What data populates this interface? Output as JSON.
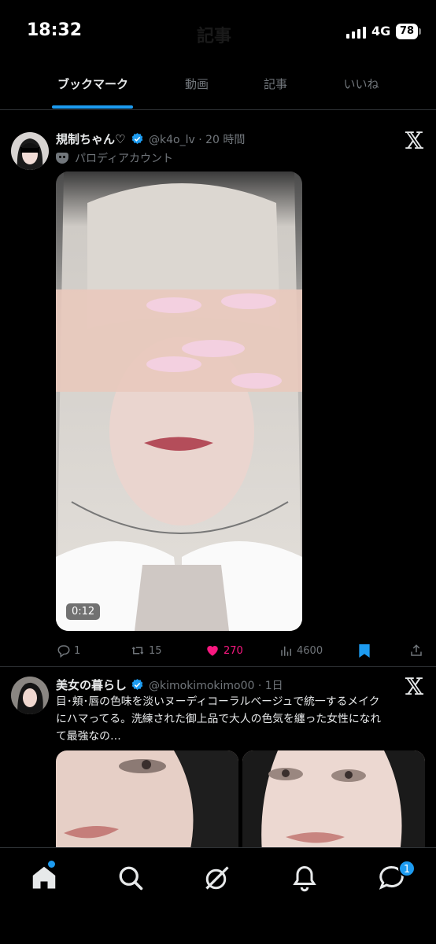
{
  "status_bar": {
    "time": "18:32",
    "network": "4G",
    "battery": "78",
    "faded_title": "記事"
  },
  "tabs": [
    {
      "label": "ブックマーク",
      "active": true
    },
    {
      "label": "動画",
      "active": false
    },
    {
      "label": "記事",
      "active": false
    },
    {
      "label": "いいね",
      "active": false
    }
  ],
  "tweets": [
    {
      "display_name": "規制ちゃん♡",
      "handle_time": "@k4o_lv · 20 時間",
      "parody_label": "パロディアカウント",
      "video_duration": "0:12",
      "replies": "1",
      "retweets": "15",
      "likes": "270",
      "views": "4600"
    },
    {
      "display_name": "美女の暮らし",
      "handle_time": "@kimokimokimo00 · 1日",
      "text_line1": "目･頬･唇の色味を淡いヌーディコーラルベージュで統一するメイク",
      "text_line2": "にハマってる。洗練された御上品で大人の色気を纏った女性になれ",
      "text_line3": "て最強なの…"
    }
  ],
  "bottom_nav": {
    "messages_badge": "1",
    "icons": [
      "home-icon",
      "search-icon",
      "grok-icon",
      "bell-icon",
      "messages-icon"
    ]
  },
  "colors": {
    "accent": "#1d9bf0",
    "like": "#f91880",
    "muted": "#71767b"
  }
}
